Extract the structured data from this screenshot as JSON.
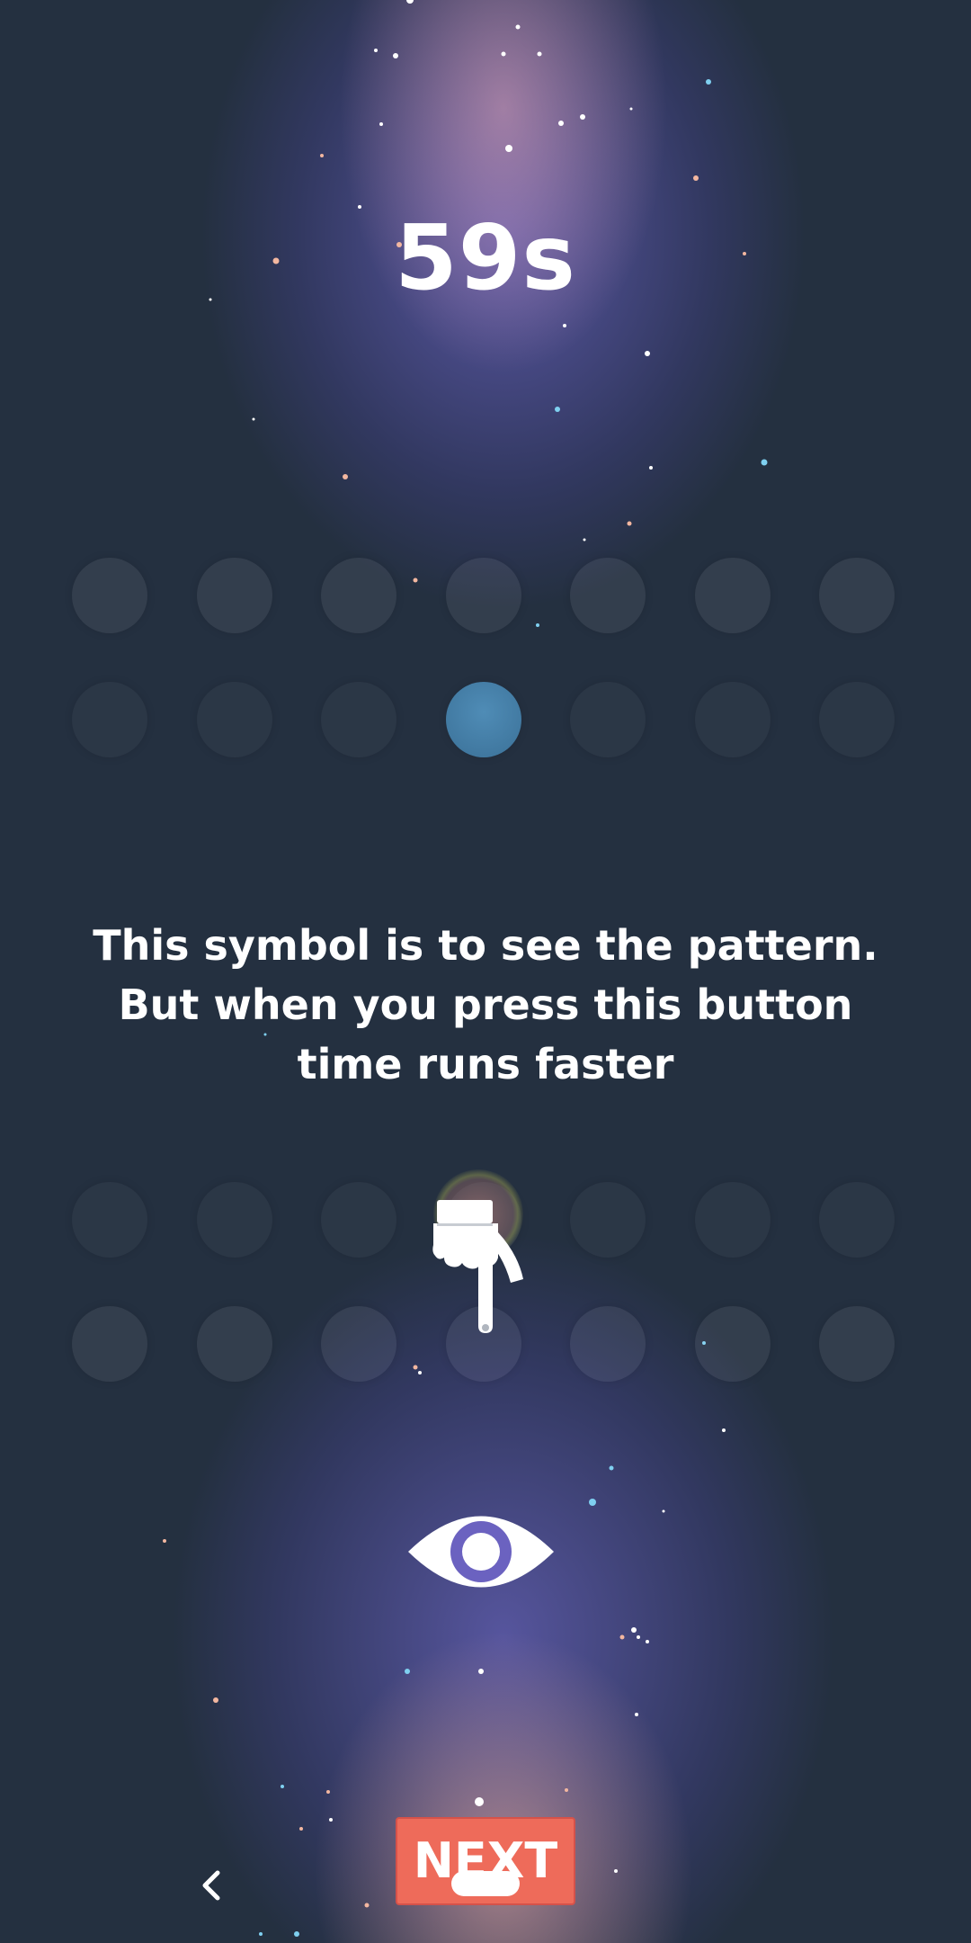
{
  "timer": {
    "text": "59s"
  },
  "top_grid": {
    "rows": [
      [
        0,
        0,
        0,
        0,
        0,
        0,
        0
      ],
      [
        0,
        0,
        0,
        1,
        0,
        0,
        0
      ]
    ],
    "active_color": "#3b7198"
  },
  "hint": {
    "text": "This symbol is to see the pattern. But when you press this button time runs faster"
  },
  "bottom_grid": {
    "rows": [
      [
        0,
        0,
        0,
        0,
        0,
        0,
        0
      ],
      [
        0,
        0,
        0,
        0,
        0,
        0,
        0
      ]
    ]
  },
  "icons": {
    "hand": "pointing-hand-icon",
    "eye": "eye-icon",
    "back": "chevron-left-icon"
  },
  "next_button": {
    "label": "NEXT",
    "color": "#ee6b5a"
  },
  "colors": {
    "background": "#243040",
    "glow": "#8a7ee0",
    "text": "#ffffff"
  }
}
